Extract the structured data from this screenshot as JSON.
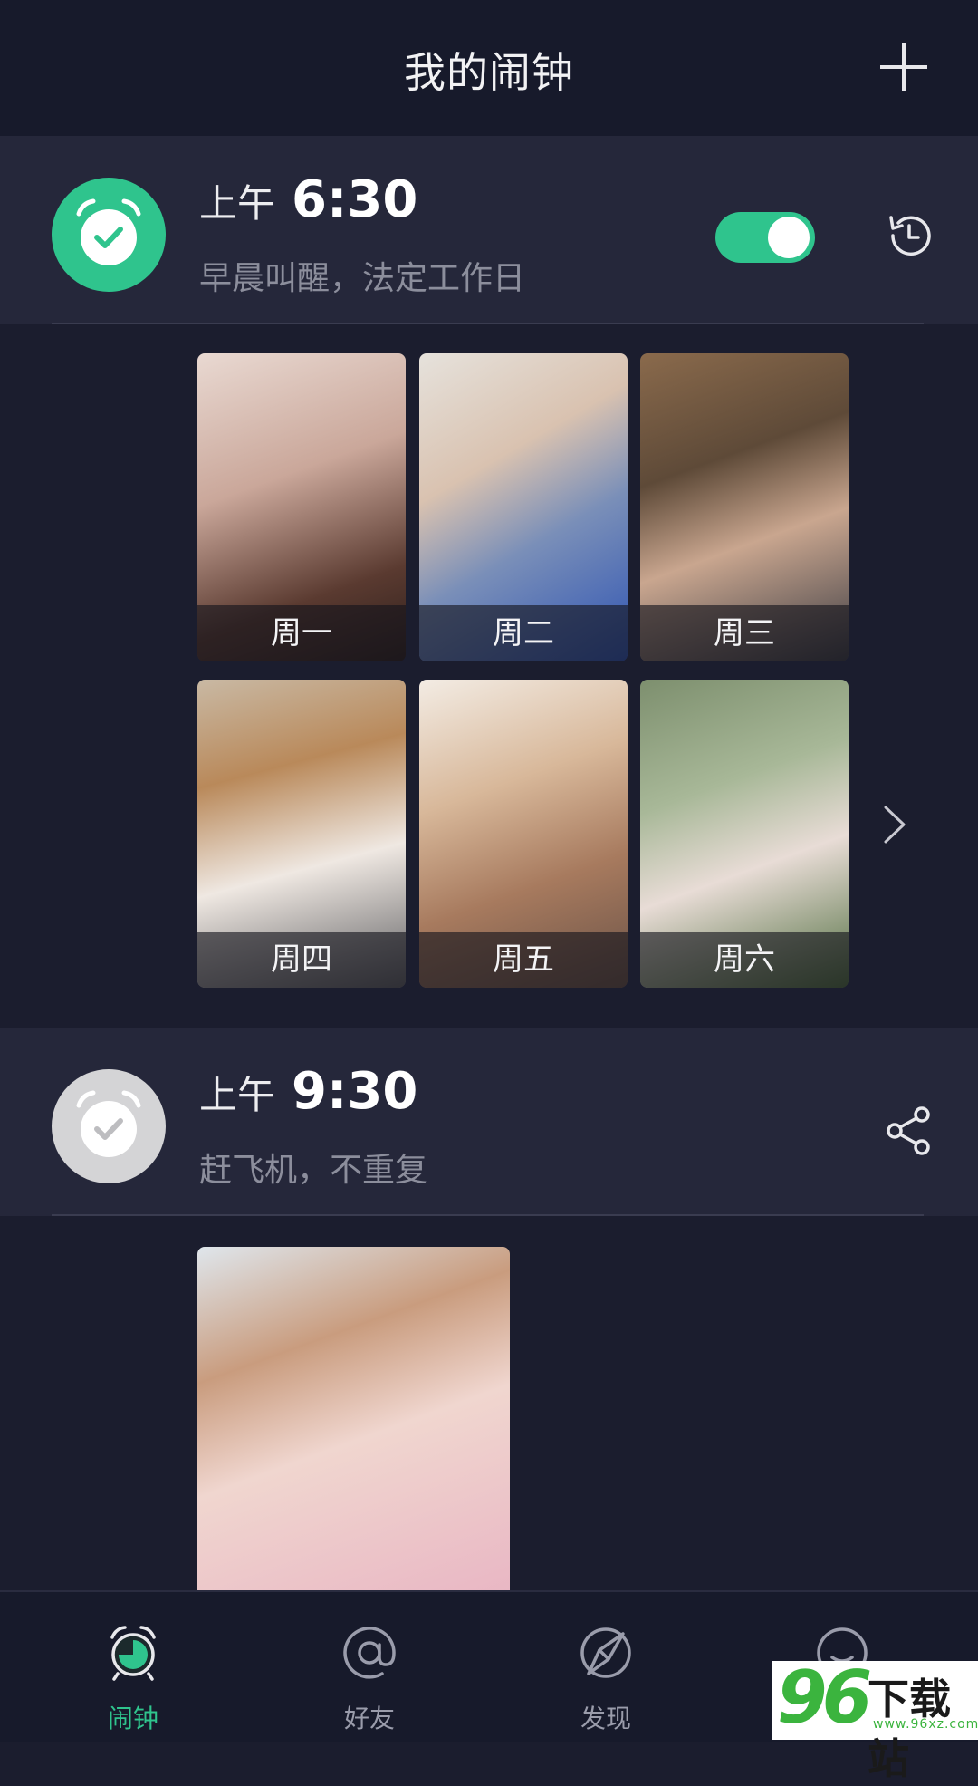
{
  "header": {
    "title": "我的闹钟",
    "add_icon": "plus-icon"
  },
  "alarms": [
    {
      "ampm": "上午",
      "time": "6:30",
      "description": "早晨叫醒，法定工作日",
      "enabled": true,
      "icon": "alarm-clock-check-icon",
      "icon_color": "#2fc48d",
      "action_icon": "history-icon",
      "days": [
        "周一",
        "周二",
        "周三",
        "周四",
        "周五",
        "周六"
      ]
    },
    {
      "ampm": "上午",
      "time": "9:30",
      "description": "赶飞机，不重复",
      "enabled": false,
      "icon": "alarm-clock-check-icon",
      "icon_color": "#d4d4d6",
      "action_icon": "share-icon"
    }
  ],
  "tabs": [
    {
      "label": "闹钟",
      "icon": "alarm-clock-icon",
      "active": true
    },
    {
      "label": "好友",
      "icon": "at-sign-icon",
      "active": false
    },
    {
      "label": "发现",
      "icon": "compass-icon",
      "active": false
    },
    {
      "label": "",
      "icon": "profile-icon",
      "active": false
    }
  ],
  "watermark": {
    "number": "96",
    "text": "下载站",
    "url": "www.96xz.com"
  },
  "colors": {
    "accent": "#2fc48d",
    "background": "#1b1d2e",
    "card": "#25273a",
    "muted": "#8c8e9c"
  }
}
